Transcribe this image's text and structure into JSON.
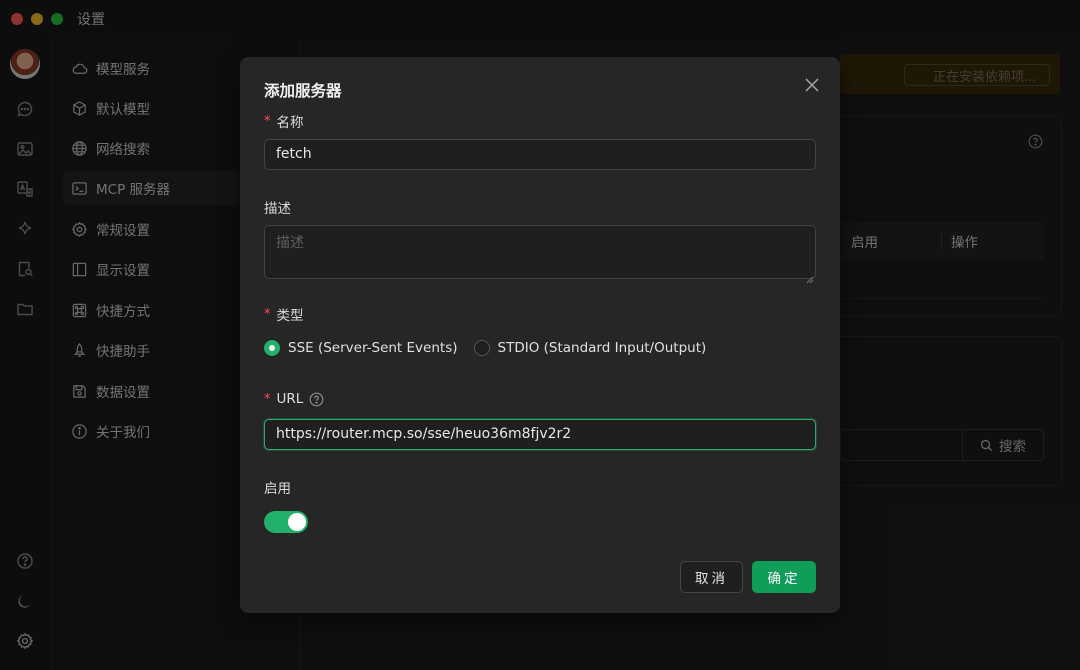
{
  "window": {
    "title": "设置"
  },
  "sidebar": {
    "items": [
      {
        "label": "模型服务",
        "icon": "cloud-icon"
      },
      {
        "label": "默认模型",
        "icon": "cube-icon"
      },
      {
        "label": "网络搜索",
        "icon": "globe-icon"
      },
      {
        "label": "MCP 服务器",
        "icon": "terminal-icon"
      },
      {
        "label": "常规设置",
        "icon": "gear-icon"
      },
      {
        "label": "显示设置",
        "icon": "layout-icon"
      },
      {
        "label": "快捷方式",
        "icon": "command-icon"
      },
      {
        "label": "快捷助手",
        "icon": "rocket-icon"
      },
      {
        "label": "数据设置",
        "icon": "save-icon"
      },
      {
        "label": "关于我们",
        "icon": "info-icon"
      }
    ]
  },
  "background": {
    "install_status": "正在安装依赖项...",
    "table_headers": [
      "启用",
      "操作"
    ],
    "search_label": "搜索"
  },
  "modal": {
    "title": "添加服务器",
    "name_label": "名称",
    "name_value": "fetch",
    "desc_label": "描述",
    "desc_placeholder": "描述",
    "type_label": "类型",
    "type_options": [
      "SSE (Server-Sent Events)",
      "STDIO (Standard Input/Output)"
    ],
    "type_selected": "SSE (Server-Sent Events)",
    "url_label": "URL",
    "url_value": "https://router.mcp.so/sse/heuo36m8fjv2r2",
    "enable_label": "启用",
    "enabled": true,
    "cancel_label": "取消",
    "ok_label": "确定"
  },
  "colors": {
    "accent": "#22b06a",
    "button_primary": "#0f9d5a",
    "required": "#ff4d4f"
  }
}
